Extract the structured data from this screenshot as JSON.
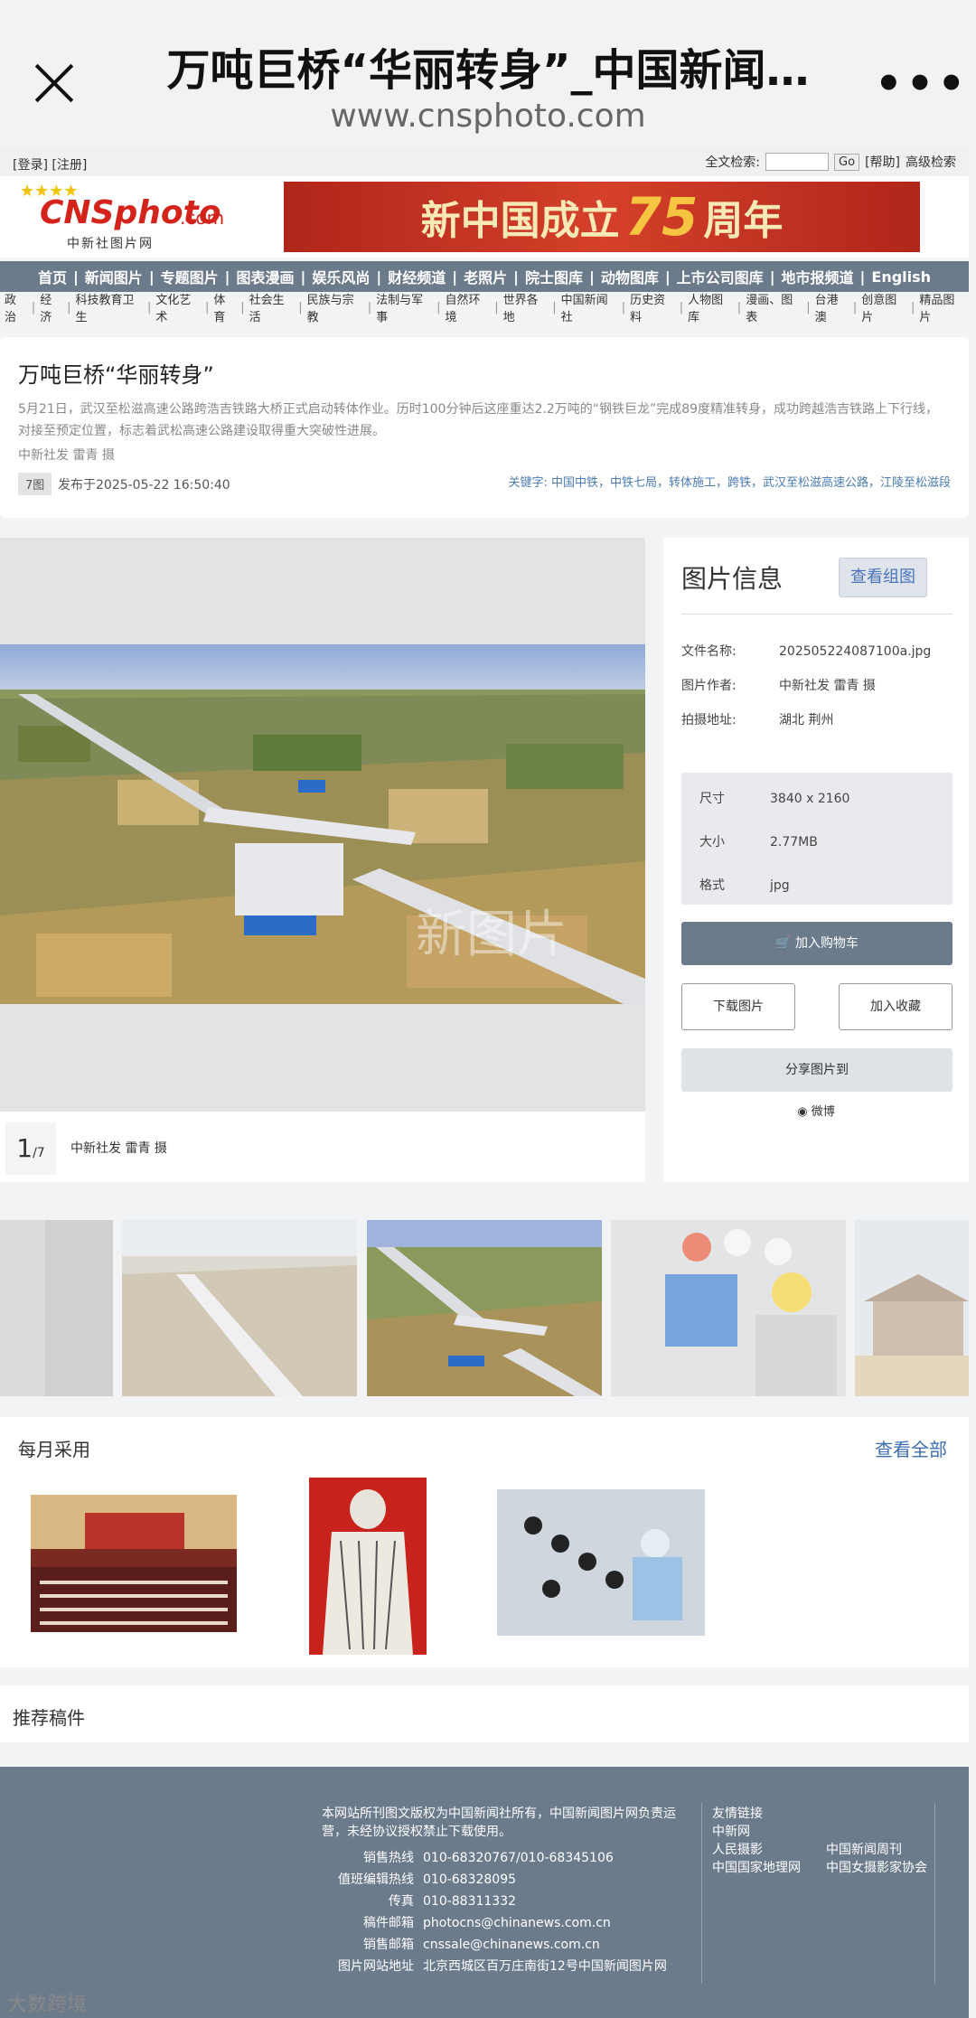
{
  "browser": {
    "title": "万吨巨桥“华丽转身”_中国新闻…",
    "url": "www.cnsphoto.com"
  },
  "utility": {
    "login": "[登录]",
    "register": "[注册]",
    "search_label": "全文检索:",
    "go": "Go",
    "help": "[帮助]",
    "advanced": "高级检索"
  },
  "brand": {
    "logo_main": "CNSphoto",
    "logo_com": ".com",
    "logo_zh": "中新社图片网",
    "banner": "新中国成立",
    "banner_num": "75",
    "banner_end": "周年"
  },
  "nav": [
    "首页",
    "新闻图片",
    "专题图片",
    "图表漫画",
    "娱乐风尚",
    "财经频道",
    "老照片",
    "院士图库",
    "动物图库",
    "上市公司图库",
    "地市报频道",
    "English"
  ],
  "subnav": [
    "政治",
    "经济",
    "科技教育卫生",
    "文化艺术",
    "体育",
    "社会生活",
    "民族与宗教",
    "法制与军事",
    "自然环境",
    "世界各地",
    "中国新闻社",
    "历史资料",
    "人物图库",
    "漫画、图表",
    "台港澳",
    "创意图片",
    "精品图片"
  ],
  "article": {
    "title": "万吨巨桥“华丽转身”",
    "desc": "5月21日，武汉至松滋高速公路跨浩吉铁路大桥正式启动转体作业。历时100分钟后这座重达2.2万吨的“钢铁巨龙”完成89度精准转身，成功跨越浩吉铁路上下行线，对接至预定位置，标志着武松高速公路建设取得重大突破性进展。",
    "byline": "中新社发 雷青 摄",
    "count": "7图",
    "published": "发布于2025-05-22 16:50:40",
    "keywords": "关键字: 中国中铁，中铁七局，转体施工，跨铁，武汉至松滋高速公路，江陵至松滋段"
  },
  "viewer": {
    "page": "1",
    "total": "/7",
    "caption": "中新社发 雷青 摄"
  },
  "info": {
    "heading": "图片信息",
    "view_group": "查看组图",
    "filename_label": "文件名称:",
    "filename": "202505224087100a.jpg",
    "author_label": "图片作者:",
    "author": "中新社发 雷青 摄",
    "place_label": "拍摄地址:",
    "place": "湖北 荆州",
    "size_label": "尺寸",
    "size": "3840 x 2160",
    "bytes_label": "大小",
    "bytes": "2.77MB",
    "format_label": "格式",
    "format": "jpg",
    "cart": "加入购物车",
    "download": "下载图片",
    "favorite": "加入收藏",
    "share": "分享图片到",
    "weibo": "微博"
  },
  "monthly": {
    "heading": "每月采用",
    "view_all": "查看全部"
  },
  "recommend": {
    "heading": "推荐稿件"
  },
  "footer": {
    "copyright": "本网站所刊图文版权为中国新闻社所有，中国新闻图片网负责运营，未经协议授权禁止下载使用。",
    "rows": [
      {
        "label": "销售热线",
        "value": "010-68320767/010-68345106"
      },
      {
        "label": "值班编辑热线",
        "value": "010-68328095"
      },
      {
        "label": "传真",
        "value": "010-88311332"
      },
      {
        "label": "稿件邮箱",
        "value": "photocns@chinanews.com.cn"
      },
      {
        "label": "销售邮箱",
        "value": "cnssale@chinanews.com.cn"
      },
      {
        "label": "图片网站地址",
        "value": "北京西城区百万庄南街12号中国新闻图片网"
      }
    ],
    "links_title": "友情链接",
    "links": [
      "中新网",
      "人民摄影",
      "中国国家地理网"
    ],
    "links2": [
      "中国新闻周刊",
      "中国女摄影家协会"
    ]
  },
  "watermark": "大数跨境"
}
